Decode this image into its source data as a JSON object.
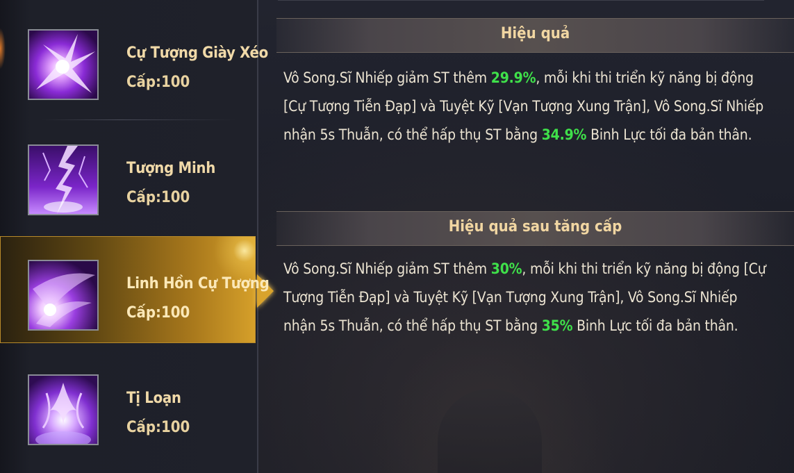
{
  "skills": [
    {
      "name": "Cự Tượng Giày Xéo",
      "level": "Cấp:100",
      "icon": "purple-claw-burst-icon",
      "selected": false
    },
    {
      "name": "Tượng Minh",
      "level": "Cấp:100",
      "icon": "purple-lightning-icon",
      "selected": false
    },
    {
      "name": "Linh Hồn Cự Tượng",
      "level": "Cấp:100",
      "icon": "purple-spirit-swirl-icon",
      "selected": true
    },
    {
      "name": "Tị Loạn",
      "level": "Cấp:100",
      "icon": "purple-flame-orb-icon",
      "selected": false
    }
  ],
  "effect": {
    "title": "Hiệu quả",
    "text_1": "Vô Song.Sĩ Nhiếp giảm ST thêm ",
    "value_1": "29.9%",
    "text_2": ", mỗi khi thi triển kỹ năng bị động [Cự Tượng Tiễn Đạp] và Tuyệt Kỹ [Vạn Tượng Xung Trận], Vô Song.Sĩ Nhiếp nhận 5s Thuẫn, có thể hấp thụ ST bằng ",
    "value_2": "34.9%",
    "text_3": " Binh Lực tối đa bản thân."
  },
  "effect_upgrade": {
    "title": "Hiệu quả sau tăng cấp",
    "text_1": "Vô Song.Sĩ Nhiếp giảm ST thêm ",
    "value_1": "30%",
    "text_2": ", mỗi khi thi triển kỹ năng bị động [Cự Tượng Tiễn Đạp] và Tuyệt Kỹ [Vạn Tượng Xung Trận], Vô Song.Sĩ Nhiếp nhận 5s Thuẫn, có thể hấp thụ ST bằng ",
    "value_2": "35%",
    "text_3": " Binh Lực tối đa bản thân."
  },
  "colors": {
    "highlight": "#3fe04a",
    "title_gold": "#f1d6a2",
    "selected_gold": "#d6a02a"
  }
}
